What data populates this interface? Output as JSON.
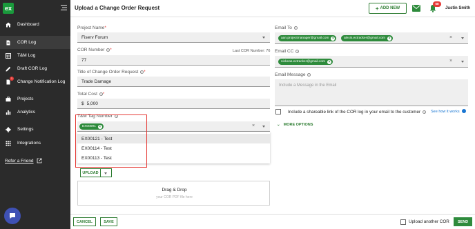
{
  "app": {
    "logo_text": "ex"
  },
  "sidebar": {
    "items": [
      {
        "label": "Dashboard",
        "icon": "home-icon"
      },
      {
        "label": "COR Log",
        "icon": "document-icon",
        "active": true
      },
      {
        "label": "T&M Log",
        "icon": "table-icon"
      },
      {
        "label": "Draft COR Log",
        "icon": "pencil-icon"
      },
      {
        "label": "Change Notification Log",
        "icon": "notification-doc-icon",
        "badge": "1"
      },
      {
        "label": "Projects",
        "icon": "briefcase-icon"
      },
      {
        "label": "Analytics",
        "icon": "bar-chart-icon"
      },
      {
        "label": "Settings",
        "icon": "gear-icon"
      },
      {
        "label": "Integrations",
        "icon": "grid-icon"
      }
    ],
    "refer": "Refer a Friend"
  },
  "header": {
    "title": "Upload a Change Order Request",
    "add_new": "ADD NEW",
    "notification_count": "58",
    "user_name": "Justin Smith"
  },
  "form": {
    "project_name": {
      "label": "Project Name",
      "value": "Fiserv Forum"
    },
    "cor_number": {
      "label": "COR Number",
      "value": "77",
      "last_cor": "Last COR Number: 76"
    },
    "title": {
      "label": "Title of Change Order Request",
      "value": "Trade Damage"
    },
    "total_cost": {
      "label": "Total Cost",
      "currency": "$",
      "value": "5,000"
    },
    "tm_tag": {
      "label": "T&M Tag Number",
      "selected_chip": "EX00091"
    },
    "tm_options": [
      "EX00121 - Test",
      "EX00114 - Test",
      "EX00113 - Test"
    ],
    "upload_label": "UPLOAD",
    "drag_drop": {
      "title": "Drag & Drop",
      "subtitle": "your COR PDF file here"
    },
    "email_to": {
      "label": "Email To",
      "chips": [
        "aan.projectmanager@gmail.com",
        "alexis.extracker@gmail.com"
      ]
    },
    "email_cc": {
      "label": "Email CC",
      "chips": [
        "nickeas.extracker@gmail.com"
      ]
    },
    "email_message": {
      "label": "Email Message",
      "placeholder": "Include a Message in the Email"
    },
    "share_link": "Include a shareable link of the COR log in your email to the customer",
    "see_how": "See how it works",
    "more_options": "MORE OPTIONS"
  },
  "footer": {
    "cancel": "CANCEL",
    "save": "SAVE",
    "upload_another": "Upload another COR",
    "send": "SEND"
  },
  "colors": {
    "accent": "#2e8b3c",
    "sidebar_bg": "#2b2b2b",
    "highlight": "#e53935"
  }
}
